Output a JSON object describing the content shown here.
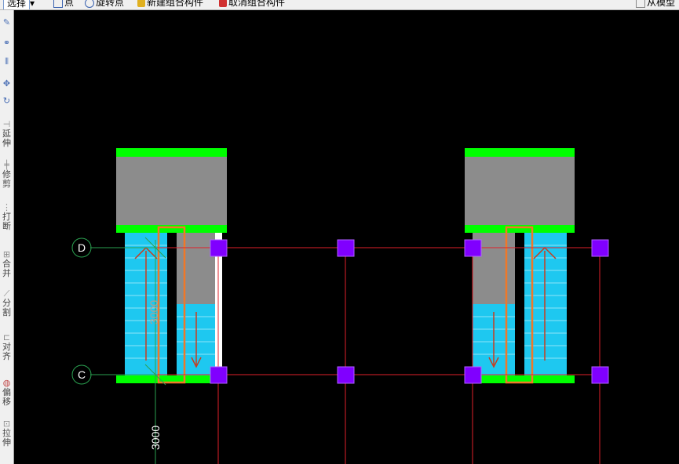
{
  "toolbar": {
    "select_label": "选择",
    "point_label": "点",
    "rotate_point_label": "旋转点",
    "new_group_label": "新建组合构件",
    "cancel_group_label": "取消组合构件",
    "from_model_label": "从模型"
  },
  "sidebar": {
    "items": [
      {
        "icon": "brush-icon",
        "label": ""
      },
      {
        "icon": "copy-icon",
        "label": ""
      },
      {
        "icon": "mirror-icon",
        "label": ""
      },
      {
        "icon": "move-icon",
        "label": ""
      },
      {
        "icon": "rotate-icon",
        "label": ""
      },
      {
        "icon": "extend-icon",
        "label": "延伸"
      },
      {
        "icon": "trim-icon",
        "label": "修剪"
      },
      {
        "icon": "break-icon",
        "label": "打断"
      },
      {
        "icon": "merge-icon",
        "label": "合并"
      },
      {
        "icon": "split-icon",
        "label": "分割"
      },
      {
        "icon": "align-icon",
        "label": "对齐"
      },
      {
        "icon": "offset-icon",
        "label": "偏移"
      },
      {
        "icon": "stretch-icon",
        "label": "拉伸"
      }
    ]
  },
  "drawing": {
    "axis_d": "D",
    "axis_c": "C",
    "stair_dim_label": "3000",
    "bottom_dim_label": "3000",
    "colors": {
      "background": "#000000",
      "beam": "#00ff00",
      "slab": "#8c8c8c",
      "stair": "#1ec8f0",
      "column": "#8000ff",
      "axis_red": "#e0202a",
      "axis_green": "#2aa050",
      "outline_orange": "#f07828",
      "arrow": "#c83c1e"
    }
  }
}
